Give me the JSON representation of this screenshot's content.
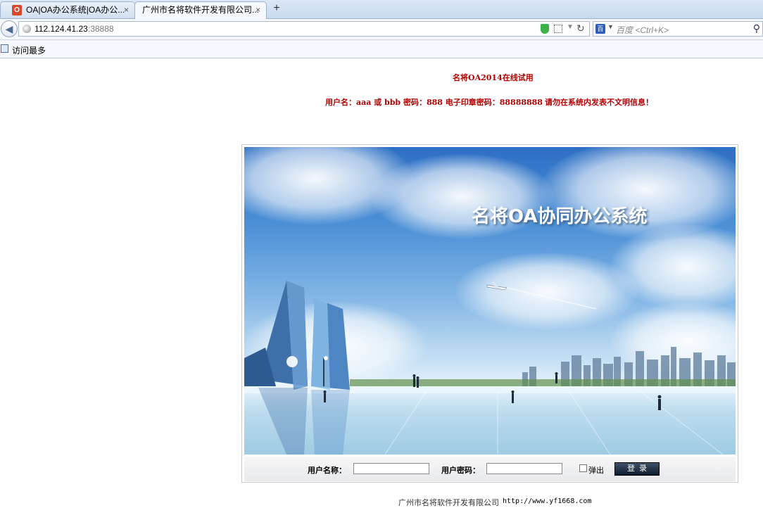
{
  "tabs": [
    {
      "label": "OA|OA办公系统|OA办公...",
      "favicon": "opera-o-icon",
      "close": "×"
    },
    {
      "label": "广州市名将软件开发有限公司...",
      "close": "×"
    }
  ],
  "new_tab": "+",
  "navbar": {
    "url_host": "112.124.41.23",
    "url_port": ":38888",
    "search_placeholder": "百度 <Ctrl+K>",
    "search_engine": "baidu-icon"
  },
  "bookmarks": {
    "most_visited": "访问最多"
  },
  "page": {
    "notice_title": "名将OA2014在线试用",
    "notice_credentials": "用户名：aaa 或 bbb 密码：888 电子印章密码：88888888",
    "notice_warning": "请勿在系统内发表不文明信息！",
    "banner_title": "名将OA协同办公系统",
    "login": {
      "username_label": "用户名称：",
      "username_value": "",
      "password_label": "用户密码：",
      "password_value": "",
      "popup_label": "弹出",
      "popup_checked": false,
      "submit_label": "登录"
    },
    "footer_company": "广州市名将软件开发有限公司",
    "footer_url": "http://www.yf1668.com"
  },
  "colors": {
    "notice_red": "#b30000",
    "sky_top": "#2e6fc4",
    "button_dark": "#0f1c2f"
  }
}
